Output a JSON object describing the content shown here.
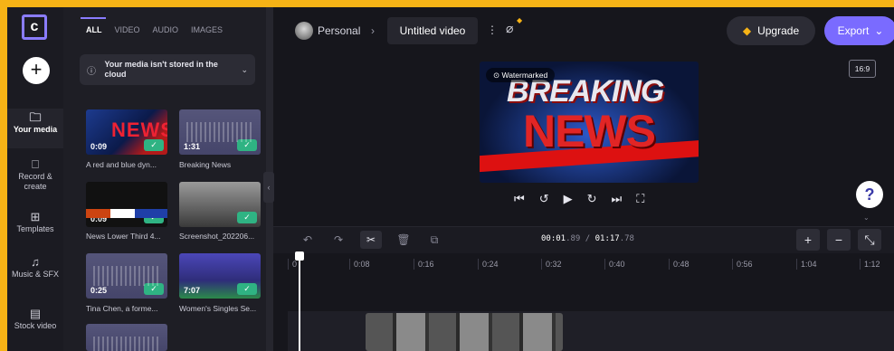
{
  "rail": {
    "logo_text": "c",
    "add_label": "+",
    "items": [
      {
        "icon": "folder-icon",
        "glyph": "🗀",
        "label": "Your media"
      },
      {
        "icon": "video-camera-icon",
        "glyph": "⎕",
        "label": "Record & create"
      },
      {
        "icon": "templates-icon",
        "glyph": "⊞",
        "label": "Templates"
      },
      {
        "icon": "music-note-icon",
        "glyph": "♫",
        "label": "Music & SFX"
      },
      {
        "icon": "stock-video-icon",
        "glyph": "▤",
        "label": "Stock video"
      }
    ]
  },
  "media": {
    "tabs": [
      "ALL",
      "VIDEO",
      "AUDIO",
      "IMAGES"
    ],
    "notice": {
      "icon": "ⓘ",
      "text": "Your media isn't stored in the cloud",
      "chevron": "⌄"
    },
    "items": [
      {
        "duration": "0:09",
        "caption": "A red and blue dyn...",
        "check": "✓"
      },
      {
        "duration": "1:31",
        "caption": "Breaking News",
        "check": "✓"
      },
      {
        "duration": "0:09",
        "caption": "News Lower Third 4...",
        "check": "✓"
      },
      {
        "duration": "",
        "caption": "Screenshot_202206...",
        "check": "✓"
      },
      {
        "duration": "0:25",
        "caption": "Tina Chen, a forme...",
        "check": "✓"
      },
      {
        "duration": "7:07",
        "caption": "Women's Singles Se...",
        "check": "✓"
      }
    ]
  },
  "topbar": {
    "workspace": "Personal",
    "separator": "›",
    "title": "Untitled video",
    "kebab": "⋮",
    "nosync_icon": "⌀",
    "upgrade_label": "Upgrade",
    "upgrade_icon": "◆",
    "export_label": "Export",
    "export_chevron": "⌄"
  },
  "preview": {
    "watermark": "Watermarked",
    "watermark_icon": "⊙",
    "line1": "BREAKING",
    "line2": "NEWS",
    "ratio": "16:9"
  },
  "controls": [
    "⏮",
    "↺",
    "▶",
    "↻",
    "⏭",
    "⛶"
  ],
  "help_label": "?",
  "timeline": {
    "undo": "↶",
    "redo": "↷",
    "cut": "✂",
    "delete": "🗑",
    "duplicate": "⧉",
    "timecode_current": "00:01",
    "timecode_current_frac": ".89",
    "timecode_divider": " / ",
    "timecode_total": "01:17",
    "timecode_total_frac": ".78",
    "zoom_in": "+",
    "zoom_out": "−",
    "fit": "⤡",
    "ticks": [
      "0",
      "0:08",
      "0:16",
      "0:24",
      "0:32",
      "0:40",
      "0:48",
      "0:56",
      "1:04",
      "1:12"
    ]
  }
}
